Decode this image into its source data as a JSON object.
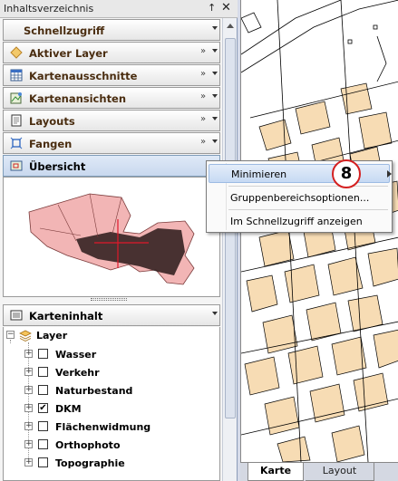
{
  "panel": {
    "title": "Inhaltsverzeichnis",
    "pin_glyph": "↑",
    "close_glyph": "✕",
    "groups": [
      {
        "label": "Schnellzugriff",
        "icon": "none",
        "double_chevron": false
      },
      {
        "label": "Aktiver Layer",
        "icon": "diamond-icon",
        "double_chevron": true
      },
      {
        "label": "Kartenausschnitte",
        "icon": "grid-icon",
        "double_chevron": true
      },
      {
        "label": "Kartenansichten",
        "icon": "map-view-icon",
        "double_chevron": true
      },
      {
        "label": "Layouts",
        "icon": "layout-icon",
        "double_chevron": true
      },
      {
        "label": "Fangen",
        "icon": "snap-icon",
        "double_chevron": true
      },
      {
        "label": "Übersicht",
        "icon": "overview-icon",
        "double_chevron": false,
        "active": true
      }
    ],
    "double_chevron_glyph": "»",
    "karteninhalt": {
      "label": "Karteninhalt",
      "root": {
        "label": "Layer",
        "expand_glyph": "−"
      },
      "layers": [
        {
          "label": "Wasser",
          "checked": false
        },
        {
          "label": "Verkehr",
          "checked": false
        },
        {
          "label": "Naturbestand",
          "checked": false
        },
        {
          "label": "DKM",
          "checked": true
        },
        {
          "label": "Flächenwidmung",
          "checked": false
        },
        {
          "label": "Orthophoto",
          "checked": false
        },
        {
          "label": "Topographie",
          "checked": false
        }
      ],
      "expand_glyph": "+",
      "check_glyph": "✔"
    }
  },
  "context_menu": {
    "items": [
      {
        "label": "Minimieren",
        "highlighted": true
      },
      {
        "label": "Gruppenbereichsoptionen..."
      },
      {
        "label": "Im Schnellzugriff anzeigen"
      }
    ]
  },
  "badge": {
    "number": "8",
    "color": "#d42020"
  },
  "map_tabs": [
    {
      "label": "Karte",
      "active": true
    },
    {
      "label": "Layout",
      "active": false
    }
  ],
  "colors": {
    "building_fill": "#f7dcb4",
    "overview_fill": "#f2b5b5",
    "extent_line": "#e0182a",
    "group_label": "#4a2d10"
  }
}
